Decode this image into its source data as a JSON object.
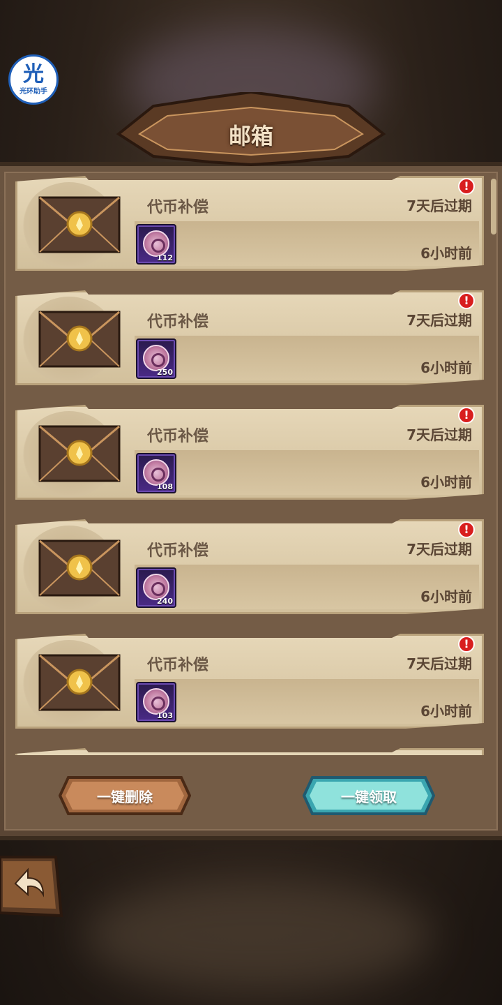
{
  "watermark": {
    "logo_char": "光",
    "logo_text": "光环助手"
  },
  "header": {
    "title": "邮箱"
  },
  "mails": [
    {
      "title": "代币补偿",
      "expire": "7天后过期",
      "time": "6小时前",
      "quantity": "112",
      "alert": "!"
    },
    {
      "title": "代币补偿",
      "expire": "7天后过期",
      "time": "6小时前",
      "quantity": "250",
      "alert": "!"
    },
    {
      "title": "代币补偿",
      "expire": "7天后过期",
      "time": "6小时前",
      "quantity": "108",
      "alert": "!"
    },
    {
      "title": "代币补偿",
      "expire": "7天后过期",
      "time": "6小时前",
      "quantity": "240",
      "alert": "!"
    },
    {
      "title": "代币补偿",
      "expire": "7天后过期",
      "time": "6小时前",
      "quantity": "103",
      "alert": "!"
    }
  ],
  "actions": {
    "delete_all": "一键删除",
    "claim_all": "一键领取"
  },
  "colors": {
    "alert": "#d81e1e",
    "claim_button": "#7fd6d6",
    "delete_button": "#a0663e"
  }
}
